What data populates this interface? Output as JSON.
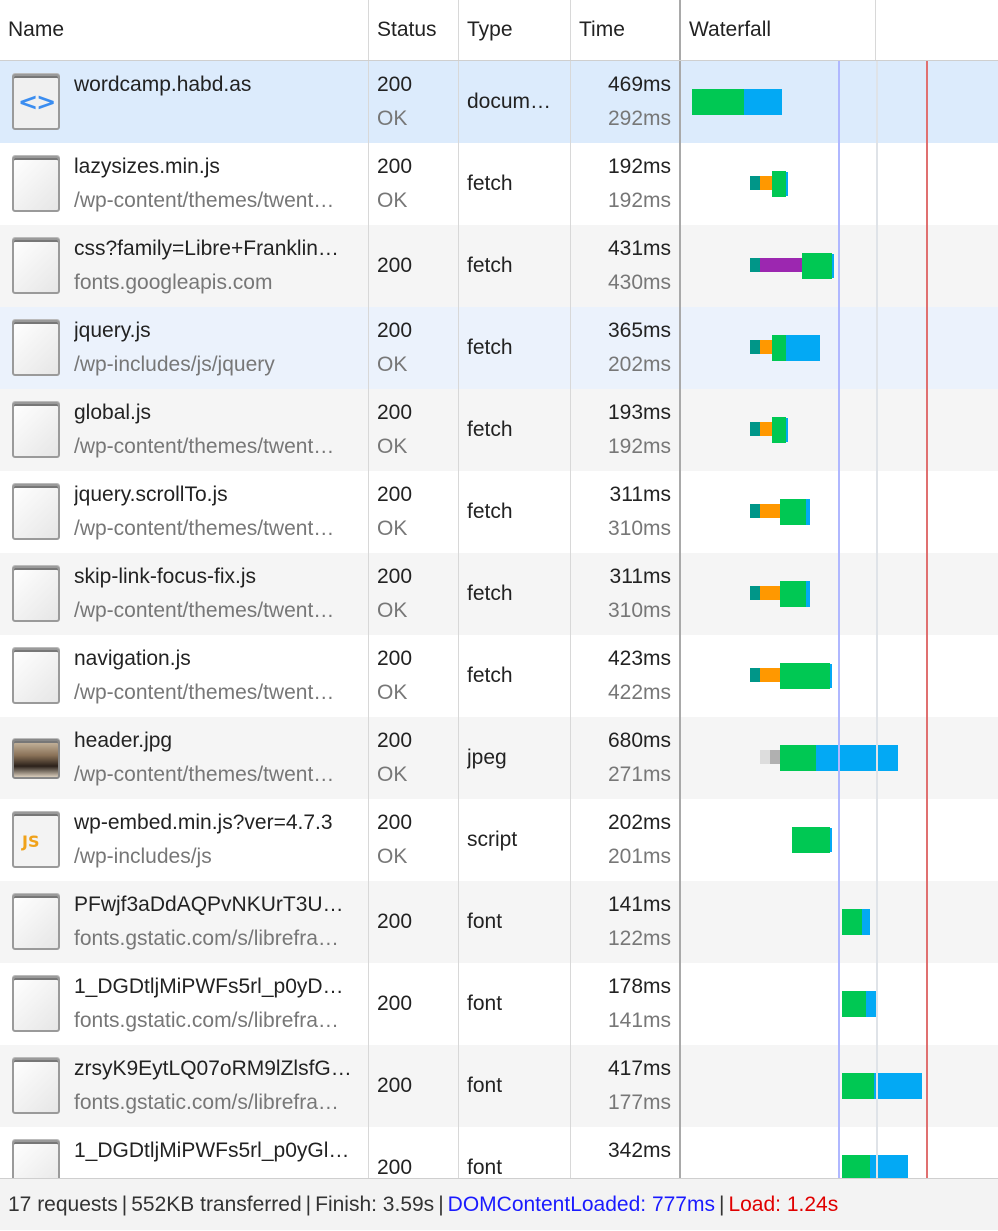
{
  "columns": [
    "Name",
    "Status",
    "Type",
    "Time",
    "Waterfall"
  ],
  "colors": {
    "queue": "#dddddd",
    "stalled": "#b0b0b0",
    "dns": "#009688",
    "connect": "#ff9800",
    "ssl": "#9c27b0",
    "waiting": "#00c853",
    "download": "#03a9f4",
    "dcl": "#b0b8ff",
    "load": "#e07070"
  },
  "waterfall": {
    "dom_content_loaded_ms": 777,
    "load_ms": 1240
  },
  "requests": [
    {
      "name": "wordcamp.habd.as",
      "path": "",
      "status": "200",
      "status_text": "OK",
      "type": "docum…",
      "time": "469ms",
      "latency": "292ms",
      "icon": "document-icon",
      "state": "sel",
      "segs": [
        [
          "waiting",
          10,
          285
        ],
        [
          "download",
          285,
          484
        ]
      ]
    },
    {
      "name": "lazysizes.min.js",
      "path": "/wp-content/themes/twent…",
      "status": "200",
      "status_text": "OK",
      "type": "fetch",
      "time": "192ms",
      "latency": "192ms",
      "icon": "file-icon",
      "segs": [
        [
          "dns",
          316,
          369
        ],
        [
          "connect",
          369,
          432
        ],
        [
          "waiting",
          432,
          505
        ],
        [
          "download",
          505,
          516
        ]
      ]
    },
    {
      "name": "css?family=Libre+Franklin…",
      "path": "fonts.googleapis.com",
      "status": "200",
      "status_text": "",
      "type": "fetch",
      "time": "431ms",
      "latency": "430ms",
      "icon": "file-icon",
      "segs": [
        [
          "dns",
          316,
          369
        ],
        [
          "ssl",
          369,
          590
        ],
        [
          "waiting",
          590,
          747
        ],
        [
          "download",
          747,
          758
        ]
      ]
    },
    {
      "name": "jquery.js",
      "path": "/wp-includes/js/jquery",
      "status": "200",
      "status_text": "OK",
      "type": "fetch",
      "time": "365ms",
      "latency": "202ms",
      "icon": "file-icon",
      "state": "hov",
      "segs": [
        [
          "dns",
          316,
          369
        ],
        [
          "connect",
          369,
          432
        ],
        [
          "waiting",
          432,
          505
        ],
        [
          "download",
          505,
          684
        ]
      ]
    },
    {
      "name": "global.js",
      "path": "/wp-content/themes/twent…",
      "status": "200",
      "status_text": "OK",
      "type": "fetch",
      "time": "193ms",
      "latency": "192ms",
      "icon": "file-icon",
      "segs": [
        [
          "dns",
          316,
          369
        ],
        [
          "connect",
          369,
          432
        ],
        [
          "waiting",
          432,
          505
        ],
        [
          "download",
          505,
          516
        ]
      ]
    },
    {
      "name": "jquery.scrollTo.js",
      "path": "/wp-content/themes/twent…",
      "status": "200",
      "status_text": "OK",
      "type": "fetch",
      "time": "311ms",
      "latency": "310ms",
      "icon": "file-icon",
      "segs": [
        [
          "dns",
          316,
          369
        ],
        [
          "connect",
          369,
          474
        ],
        [
          "waiting",
          474,
          611
        ],
        [
          "download",
          611,
          632
        ]
      ]
    },
    {
      "name": "skip-link-focus-fix.js",
      "path": "/wp-content/themes/twent…",
      "status": "200",
      "status_text": "OK",
      "type": "fetch",
      "time": "311ms",
      "latency": "310ms",
      "icon": "file-icon",
      "segs": [
        [
          "dns",
          316,
          369
        ],
        [
          "connect",
          369,
          474
        ],
        [
          "waiting",
          474,
          611
        ],
        [
          "download",
          611,
          632
        ]
      ]
    },
    {
      "name": "navigation.js",
      "path": "/wp-content/themes/twent…",
      "status": "200",
      "status_text": "OK",
      "type": "fetch",
      "time": "423ms",
      "latency": "422ms",
      "icon": "file-icon",
      "segs": [
        [
          "dns",
          316,
          369
        ],
        [
          "connect",
          369,
          474
        ],
        [
          "waiting",
          474,
          737
        ],
        [
          "download",
          737,
          748
        ]
      ]
    },
    {
      "name": "header.jpg",
      "path": "/wp-content/themes/twent…",
      "status": "200",
      "status_text": "OK",
      "type": "jpeg",
      "time": "680ms",
      "latency": "271ms",
      "icon": "image-icon",
      "segs": [
        [
          "queue",
          368,
          421
        ],
        [
          "stalled",
          421,
          474
        ],
        [
          "waiting",
          474,
          663
        ],
        [
          "download",
          663,
          1095
        ]
      ]
    },
    {
      "name": "wp-embed.min.js?ver=4.7.3",
      "path": "/wp-includes/js",
      "status": "200",
      "status_text": "OK",
      "type": "script",
      "time": "202ms",
      "latency": "201ms",
      "icon": "js-icon",
      "segs": [
        [
          "waiting",
          537,
          737
        ],
        [
          "download",
          737,
          748
        ]
      ]
    },
    {
      "name": "PFwjf3aDdAQPvNKUrT3U…",
      "path": "fonts.gstatic.com/s/librefra…",
      "status": "200",
      "status_text": "",
      "type": "font",
      "time": "141ms",
      "latency": "122ms",
      "icon": "file-icon",
      "segs": [
        [
          "waiting",
          800,
          905
        ],
        [
          "download",
          905,
          947
        ]
      ]
    },
    {
      "name": "1_DGDtljMiPWFs5rl_p0yD…",
      "path": "fonts.gstatic.com/s/librefra…",
      "status": "200",
      "status_text": "",
      "type": "font",
      "time": "178ms",
      "latency": "141ms",
      "icon": "file-icon",
      "segs": [
        [
          "waiting",
          800,
          926
        ],
        [
          "download",
          926,
          989
        ]
      ]
    },
    {
      "name": "zrsyK9EytLQ07oRM9lZlsfG…",
      "path": "fonts.gstatic.com/s/librefra…",
      "status": "200",
      "status_text": "",
      "type": "font",
      "time": "417ms",
      "latency": "177ms",
      "icon": "file-icon",
      "segs": [
        [
          "waiting",
          800,
          968
        ],
        [
          "download",
          968,
          1221
        ]
      ]
    },
    {
      "name": "1_DGDtljMiPWFs5rl_p0yGl…",
      "path": "",
      "status": "200",
      "status_text": "",
      "type": "font",
      "time": "342ms",
      "latency": "",
      "icon": "file-icon",
      "segs": [
        [
          "waiting",
          800,
          947
        ],
        [
          "download",
          947,
          1147
        ]
      ]
    }
  ],
  "footer": {
    "requests": "17 requests",
    "transferred": "552KB transferred",
    "finish": "Finish: 3.59s",
    "dcl": "DOMContentLoaded: 777ms",
    "load": "Load: 1.24s",
    "separator": "|"
  }
}
